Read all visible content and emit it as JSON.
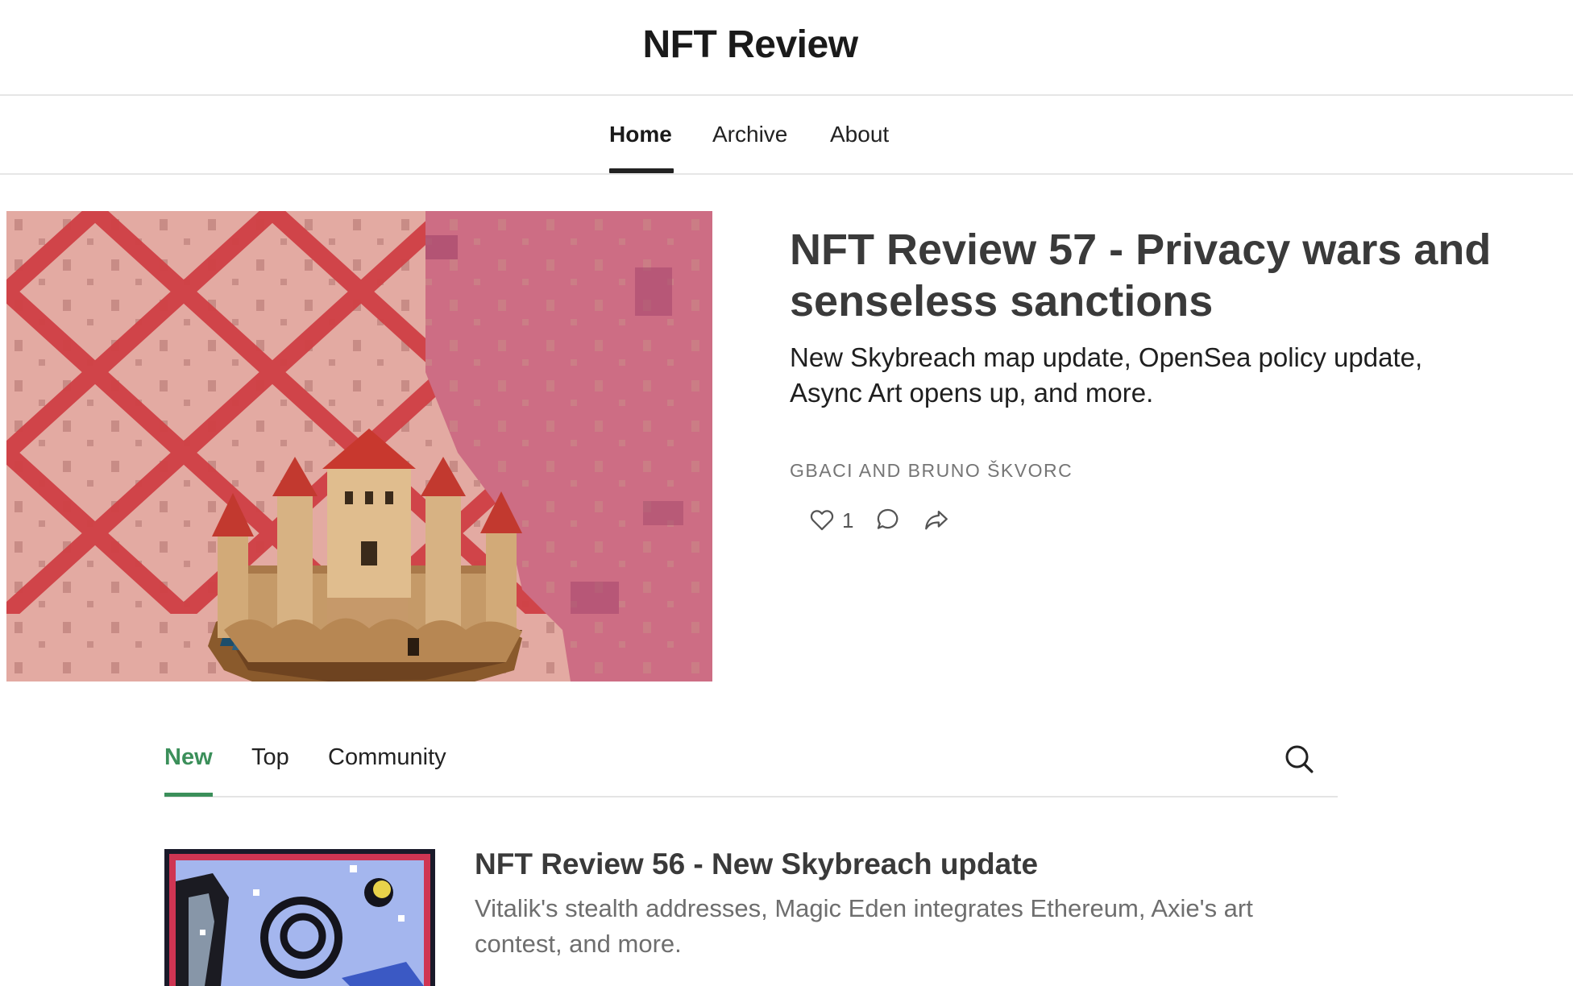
{
  "site": {
    "title": "NFT Review"
  },
  "nav": {
    "tabs": [
      {
        "label": "Home",
        "active": true
      },
      {
        "label": "Archive"
      },
      {
        "label": "About"
      }
    ]
  },
  "featured": {
    "image": "pixel-art-castle",
    "title": "NFT Review 57 - Privacy wars and senseless sanctions",
    "subtitle": "New Skybreach map update, OpenSea policy update, Async Art opens up, and more.",
    "authors": "GBACI AND BRUNO ŠKVORC",
    "likes": "1",
    "icons": {
      "like": "heart-icon",
      "comment": "comment-icon",
      "share": "share-icon"
    }
  },
  "feed": {
    "tabs": [
      {
        "label": "New",
        "active": true
      },
      {
        "label": "Top"
      },
      {
        "label": "Community"
      }
    ],
    "search_icon": "search-icon",
    "accent": "#3b8f5a"
  },
  "posts": [
    {
      "image": "pixel-art-night-sky",
      "title": "NFT Review 56 - New Skybreach update",
      "subtitle": "Vitalik's stealth addresses, Magic Eden integrates Ethereum, Axie's art contest, and more."
    }
  ]
}
